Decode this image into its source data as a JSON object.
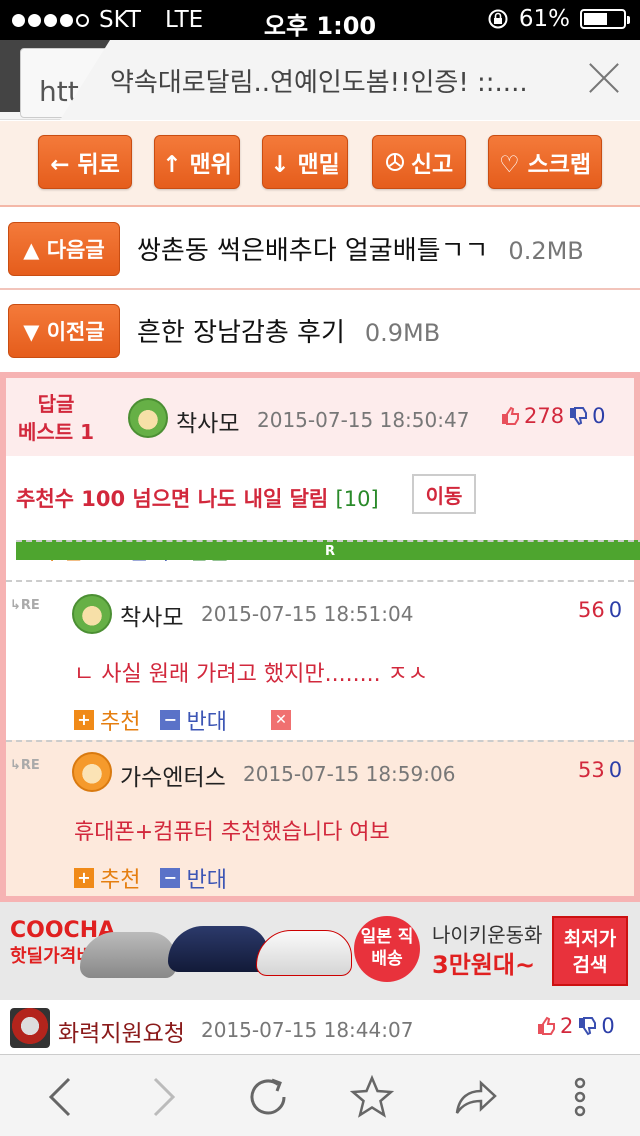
{
  "status_bar": {
    "carrier": "SKT",
    "network": "LTE",
    "time": "오후 1:00",
    "battery_percent": "61%",
    "battery_level": 0.61
  },
  "title_bar": {
    "url_fragment": "htt",
    "page_title": "약속대로달림..연예인도봄!!인증! ::...."
  },
  "toolbar": {
    "back": "← 뒤로",
    "top": "↑ 맨위",
    "bottom": "↓ 맨밑",
    "report": "신고",
    "scrap": "♡ 스크랩"
  },
  "next_post": {
    "label": "▲ 다음글",
    "title": "쌍촌동 썩은배추다 얼굴배틀ㄱㄱ",
    "size": "0.2MB"
  },
  "prev_post": {
    "label": "▼ 이전글",
    "title": "흔한 장남감총 후기",
    "size": "0.9MB"
  },
  "best_comment": {
    "badge_line1": "답글",
    "badge_line2": "베스트 1",
    "author": "착사모",
    "date": "2015-07-15 18:50:47",
    "likes": "278",
    "dislikes": "0",
    "text": "추천수 100 넘으면 나도 내일 달림",
    "reply_count": "[10]",
    "move_label": "이동"
  },
  "actions": {
    "recommend": "추천",
    "oppose": "반대",
    "reply": "답글",
    "re_tag": "RE"
  },
  "replies": [
    {
      "author": "착사모",
      "date": "2015-07-15 18:51:04",
      "likes": "56",
      "dislikes": "0",
      "text": "ㄴ 사실 원래 가려고 했지만........ ㅈㅅ"
    },
    {
      "author": "가수엔터스",
      "date": "2015-07-15 18:59:06",
      "likes": "53",
      "dislikes": "0",
      "text": "휴대폰+컴퓨터 추천했습니다 여보"
    }
  ],
  "ad": {
    "brand": "COOCHA",
    "brand_sub": "핫딜가격비교",
    "badge": "일본 직배송",
    "line1": "나이키운동화",
    "line2": "3만원대~",
    "cta": "최저가 검색"
  },
  "next_comment": {
    "author": "화력지원요청",
    "date": "2015-07-15 18:44:07",
    "likes": "2",
    "dislikes": "0"
  }
}
